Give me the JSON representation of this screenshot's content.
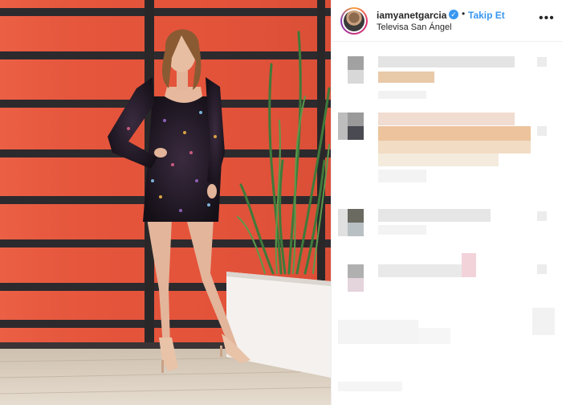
{
  "post": {
    "username": "iamyanetgarcia",
    "verified": true,
    "separator": "•",
    "follow_label": "Takip Et",
    "location": "Televisa San Ángel",
    "more_icon": "more-options-icon"
  },
  "colors": {
    "link_blue": "#3897f0",
    "wall_red": "#e8573d",
    "text_dark": "#262626"
  }
}
